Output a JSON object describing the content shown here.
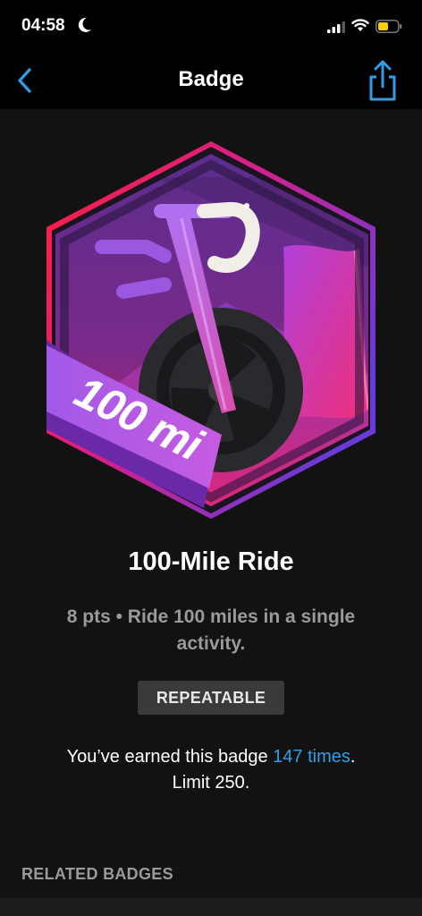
{
  "status_bar": {
    "time": "04:58",
    "icons": [
      "moon-icon",
      "cellular-signal-icon",
      "wifi-icon",
      "battery-icon"
    ],
    "battery_color": "#f5d000"
  },
  "nav": {
    "title": "Badge",
    "back_icon": "chevron-left-icon",
    "share_icon": "share-icon",
    "accent": "#2f9fe8"
  },
  "badge": {
    "art_label": "100 mi",
    "name": "100-Mile Ride",
    "description": "8 pts • Ride 100 miles in a single activity.",
    "tag": "REPEATABLE",
    "earned_prefix": "You’ve earned this badge ",
    "earned_count": "147 times",
    "earned_suffix": ".",
    "limit": "Limit 250.",
    "colors": {
      "purple": "#7a2fd0",
      "pink": "#e8287a",
      "red": "#ff2045"
    }
  },
  "related": {
    "header": "RELATED BADGES"
  }
}
